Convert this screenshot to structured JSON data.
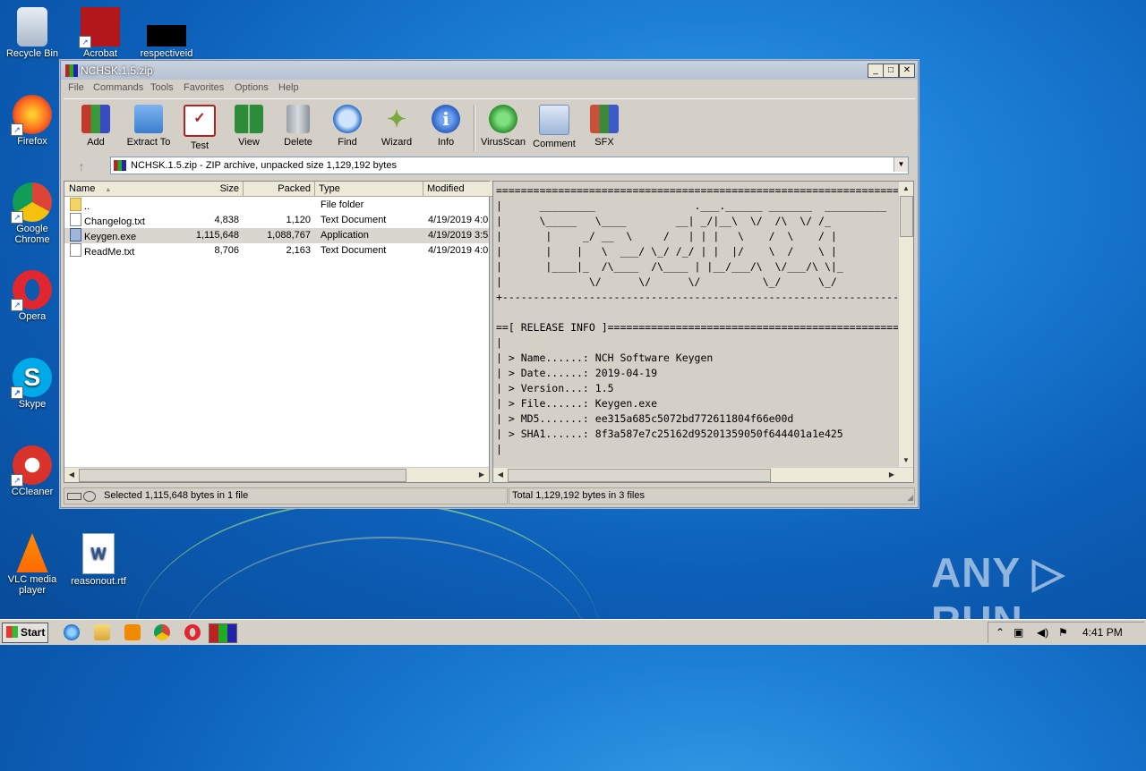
{
  "desktop": {
    "icons": [
      {
        "label": "Recycle Bin"
      },
      {
        "label": "Acrobat"
      },
      {
        "label": "respectiveid"
      },
      {
        "label": "Firefox"
      },
      {
        "label": "Google Chrome"
      },
      {
        "label": "Opera"
      },
      {
        "label": "Skype"
      },
      {
        "label": "CCleaner"
      },
      {
        "label": "VLC media player"
      },
      {
        "label": "reasonout.rtf"
      }
    ],
    "watermark": "ANY ▷ RUN"
  },
  "window": {
    "title": "NCHSK.1.5.zip",
    "menu": [
      "File",
      "Commands",
      "Tools",
      "Favorites",
      "Options",
      "Help"
    ],
    "toolbar": [
      {
        "label": "Add",
        "icon": "add-archive-icon",
        "color": "#c23a2a"
      },
      {
        "label": "Extract To",
        "icon": "extract-folder-icon",
        "color": "#3b7fd0"
      },
      {
        "label": "Test",
        "icon": "test-clipboard-icon",
        "color": "#b22222"
      },
      {
        "label": "View",
        "icon": "view-book-icon",
        "color": "#2e8b3a"
      },
      {
        "label": "Delete",
        "icon": "delete-trash-icon",
        "color": "#8a9099"
      },
      {
        "label": "Find",
        "icon": "find-magnifier-icon",
        "color": "#2a6fc9"
      },
      {
        "label": "Wizard",
        "icon": "wizard-wand-icon",
        "color": "#7aa83a"
      },
      {
        "label": "Info",
        "icon": "info-icon",
        "color": "#2a5fc0"
      },
      {
        "label": "VirusScan",
        "icon": "virus-scan-icon",
        "color": "#2f8f2f"
      },
      {
        "label": "Comment",
        "icon": "comment-icon",
        "color": "#6b8fc0"
      },
      {
        "label": "SFX",
        "icon": "sfx-books-icon",
        "color": "#c9503a"
      }
    ],
    "address": "NCHSK.1.5.zip - ZIP archive, unpacked size 1,129,192 bytes",
    "columns": [
      "Name",
      "Size",
      "Packed",
      "Type",
      "Modified"
    ],
    "files": [
      {
        "name": "..",
        "size": "",
        "packed": "",
        "type": "File folder",
        "modified": "",
        "kind": "folder",
        "selected": false
      },
      {
        "name": "Changelog.txt",
        "size": "4,838",
        "packed": "1,120",
        "type": "Text Document",
        "modified": "4/19/2019 4:0",
        "kind": "txt",
        "selected": false
      },
      {
        "name": "Keygen.exe",
        "size": "1,115,648",
        "packed": "1,088,767",
        "type": "Application",
        "modified": "4/19/2019 3:5",
        "kind": "exe",
        "selected": true
      },
      {
        "name": "ReadMe.txt",
        "size": "8,706",
        "packed": "2,163",
        "type": "Text Document",
        "modified": "4/19/2019 4:0",
        "kind": "txt",
        "selected": false
      }
    ],
    "preview_lines": [
      "=================================================================",
      "|      _________                .___.______ _______  __________",
      "|      \\_____   \\____        __| _/|__\\  \\/  /\\  \\/ /_",
      "|       |     _/ __  \\     /   | | |   \\    /  \\    / |",
      "|       |    |   \\  ___/ \\_/ /_/ | |  |/    \\  /    \\ |",
      "|       |____|_  /\\____  /\\____ | |__/___/\\  \\/___/\\ \\|_",
      "|              \\/      \\/      \\/          \\_/      \\_/",
      "+----------------------------------------------------------------",
      "",
      "==[ RELEASE INFO ]================================================",
      "|",
      "| > Name......: NCH Software Keygen",
      "| > Date......: 2019-04-19",
      "| > Version...: 1.5",
      "| > File......: Keygen.exe",
      "| > MD5.......: ee315a685c5072bd772611804f66e00d",
      "| > SHA1......: 8f3a587e7c25162d95201359050f644401a1e425",
      "|"
    ],
    "status_left": "Selected 1,115,648 bytes in 1 file",
    "status_right": "Total 1,129,192 bytes in 3 files"
  },
  "taskbar": {
    "start_label": "Start",
    "clock": "4:41 PM"
  }
}
